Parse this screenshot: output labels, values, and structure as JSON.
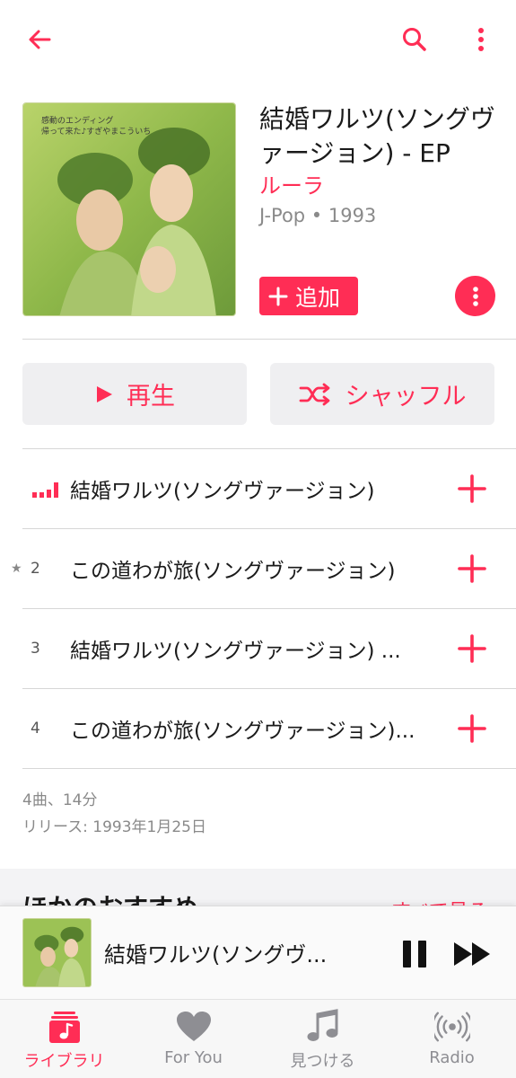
{
  "colors": {
    "accent": "#ff2d55",
    "secondary_text": "#8a8a8a",
    "button_bg": "#efeff1"
  },
  "album": {
    "title": "結婚ワルツ(ソングヴァージョン) - EP",
    "artist": "ルーラ",
    "meta": "J-Pop • 1993",
    "add_label": "追加"
  },
  "actions": {
    "play_label": "再生",
    "shuffle_label": "シャッフル"
  },
  "tracks": [
    {
      "number": "",
      "star": false,
      "playing": true,
      "title": "結婚ワルツ(ソングヴァージョン)"
    },
    {
      "number": "2",
      "star": true,
      "playing": false,
      "title": "この道わが旅(ソングヴァージョン)"
    },
    {
      "number": "3",
      "star": false,
      "playing": false,
      "title": "結婚ワルツ(ソングヴァージョン) ..."
    },
    {
      "number": "4",
      "star": false,
      "playing": false,
      "title": "この道わが旅(ソングヴァージョン)..."
    }
  ],
  "info": {
    "count_duration": "4曲、14分",
    "release": "リリース: 1993年1月25日"
  },
  "more_section": {
    "heading": "ほかのおすすめ",
    "see_all": "すべて見る"
  },
  "mini_player": {
    "title": "結婚ワルツ(ソングヴ..."
  },
  "tabs": [
    {
      "label": "ライブラリ",
      "icon": "library-icon",
      "active": true
    },
    {
      "label": "For You",
      "icon": "heart-icon",
      "active": false
    },
    {
      "label": "見つける",
      "icon": "music-note-icon",
      "active": false
    },
    {
      "label": "Radio",
      "icon": "radio-icon",
      "active": false
    }
  ]
}
